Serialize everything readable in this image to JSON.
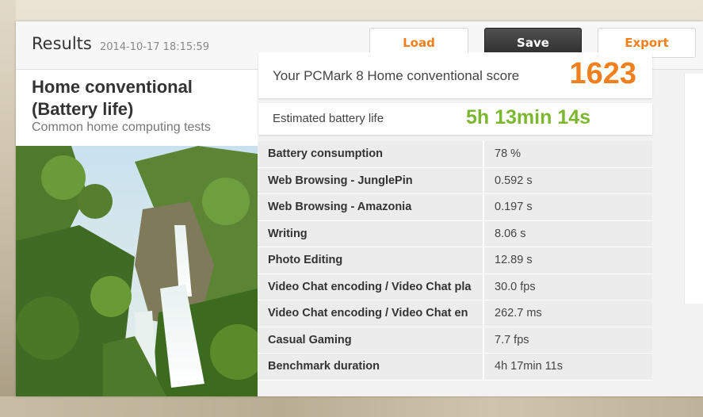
{
  "header": {
    "title": "Results",
    "date": "2014-10-17 18:15:59",
    "load_label": "Load",
    "save_label": "Save",
    "export_label": "Export"
  },
  "test": {
    "name": "Home conventional (Battery life)",
    "subtitle": "Common home computing tests"
  },
  "score": {
    "label": "Your PCMark 8 Home conventional score",
    "value": "1623"
  },
  "battery": {
    "label": "Estimated battery life",
    "value": "5h 13min 14s"
  },
  "results": [
    {
      "name": "Battery consumption",
      "value": "78 %"
    },
    {
      "name": "Web Browsing - JunglePin",
      "value": "0.592 s"
    },
    {
      "name": "Web Browsing - Amazonia",
      "value": "0.197 s"
    },
    {
      "name": "Writing",
      "value": "8.06 s"
    },
    {
      "name": "Photo Editing",
      "value": "12.89 s"
    },
    {
      "name": "Video Chat encoding / Video Chat pla",
      "value": "30.0 fps"
    },
    {
      "name": "Video Chat encoding / Video Chat en",
      "value": "262.7 ms"
    },
    {
      "name": "Casual Gaming",
      "value": "7.7 fps"
    },
    {
      "name": "Benchmark duration",
      "value": "4h 17min 11s"
    }
  ],
  "colors": {
    "accent": "#f07f1e",
    "battery": "#7cb82f"
  }
}
